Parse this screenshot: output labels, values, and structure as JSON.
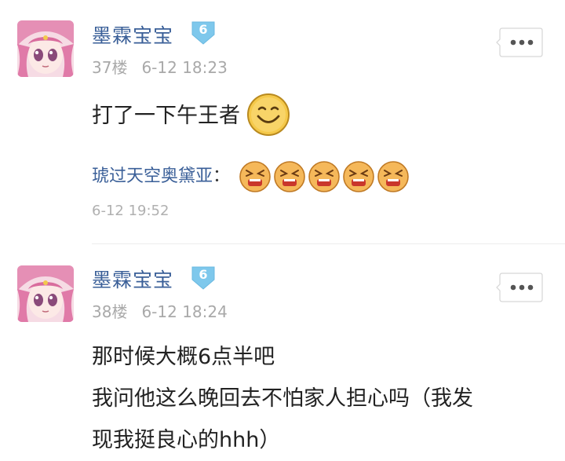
{
  "posts": [
    {
      "username": "墨霖宝宝",
      "level": "6",
      "floor": "37楼",
      "time": "6-12 18:23",
      "content_lines": [
        "打了一下午王者"
      ],
      "content_emoji": "smile-emoji",
      "reply": {
        "author": "琥过天空奥黛亚",
        "colon": "：",
        "emojis": [
          "angry-emoji",
          "angry-emoji",
          "angry-emoji",
          "angry-emoji",
          "angry-emoji"
        ],
        "time": "6-12 19:52"
      }
    },
    {
      "username": "墨霖宝宝",
      "level": "6",
      "floor": "38楼",
      "time": "6-12 18:24",
      "content_lines": [
        "那时候大概6点半吧",
        "我问他这么晚回去不怕家人担心吗（我发",
        "现我挺良心的hhh）"
      ]
    }
  ],
  "colors": {
    "username": "#3a5f98",
    "badge": "#7ec8ec",
    "meta": "#a9a9a9",
    "content": "#222222"
  }
}
